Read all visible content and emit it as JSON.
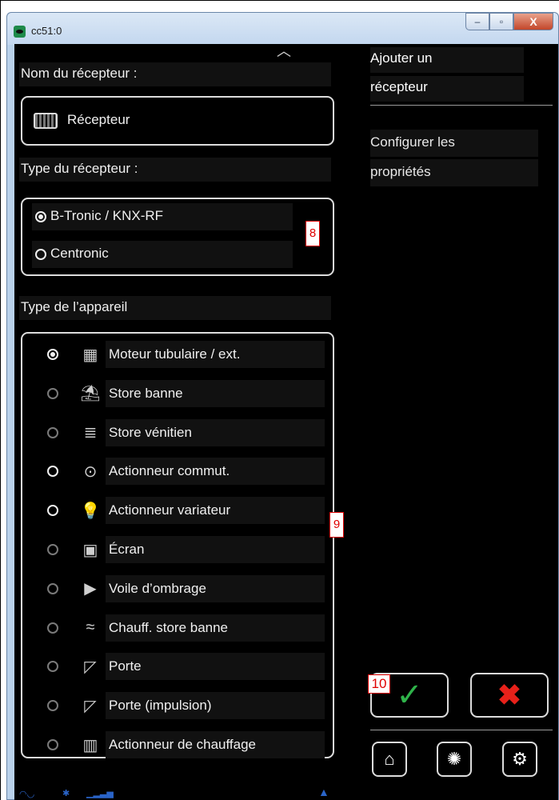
{
  "window": {
    "title": "cc51:0",
    "buttons": {
      "minimize": "–",
      "maximize": "▫",
      "close": "X"
    }
  },
  "left": {
    "receiver_name_label": "Nom du récepteur :",
    "receiver_name_value": "Récepteur",
    "receiver_type_label": "Type du récepteur :",
    "receiver_types": [
      {
        "label": "B-Tronic / KNX-RF",
        "selected": true
      },
      {
        "label": "Centronic",
        "selected": false
      }
    ],
    "device_type_label": "Type de l’appareil",
    "devices": [
      {
        "label": "Moteur tubulaire / ext.",
        "icon": "tubular-motor-icon",
        "state": "selected"
      },
      {
        "label": "Store banne",
        "icon": "awning-icon",
        "state": "dim"
      },
      {
        "label": "Store vénitien",
        "icon": "venetian-blind-icon",
        "state": "dim"
      },
      {
        "label": "Actionneur commut.",
        "icon": "switch-actuator-icon",
        "state": "normal"
      },
      {
        "label": "Actionneur variateur",
        "icon": "dimmer-bulb-icon",
        "state": "normal"
      },
      {
        "label": "Écran",
        "icon": "screen-icon",
        "state": "dim"
      },
      {
        "label": "Voile d’ombrage",
        "icon": "shade-sail-icon",
        "state": "dim"
      },
      {
        "label": "Chauff. store banne",
        "icon": "awning-heater-icon",
        "state": "dim"
      },
      {
        "label": "Porte",
        "icon": "door-icon",
        "state": "dim"
      },
      {
        "label": "Porte (impulsion)",
        "icon": "door-impulse-icon",
        "state": "dim"
      },
      {
        "label": "Actionneur de chauffage",
        "icon": "heating-actuator-icon",
        "state": "dim"
      }
    ]
  },
  "right": {
    "title_line1": "Ajouter un",
    "title_line2": "récepteur",
    "subtitle_line1": "Configurer les",
    "subtitle_line2": "propriétés"
  },
  "markers": {
    "m8": "8",
    "m9": "9",
    "m10": "10"
  },
  "colors": {
    "accept": "#2fb34a",
    "cancel": "#e8211a",
    "marker": "#e00000"
  }
}
